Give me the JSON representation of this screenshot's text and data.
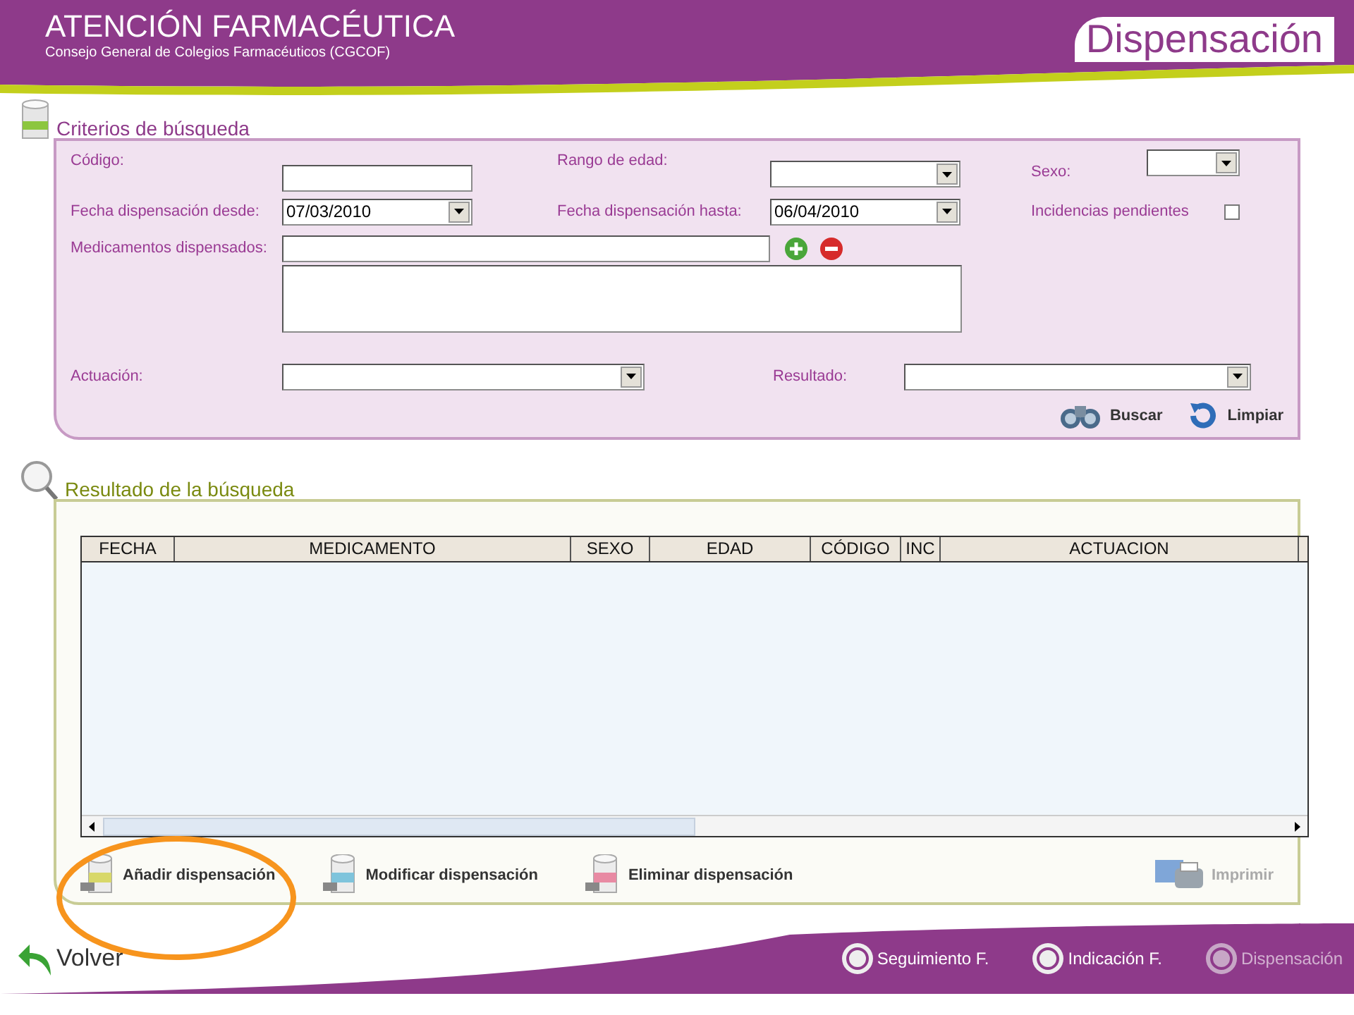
{
  "header": {
    "title": "ATENCIÓN FARMACÉUTICA",
    "subtitle": "Consejo General de Colegios Farmacéuticos (CGCOF)",
    "page_title": "Dispensación"
  },
  "search": {
    "legend": "Criterios de búsqueda",
    "codigo": {
      "label": "Código:"
    },
    "rango_edad": {
      "label": "Rango de edad:"
    },
    "sexo": {
      "label": "Sexo:"
    },
    "fecha_desde": {
      "label": "Fecha dispensación desde:",
      "value": "07/03/2010"
    },
    "fecha_hasta": {
      "label": "Fecha dispensación hasta:",
      "value": "06/04/2010"
    },
    "incidencias": {
      "label": "Incidencias pendientes",
      "checked": false
    },
    "medicamentos": {
      "label": "Medicamentos dispensados:"
    },
    "actuacion": {
      "label": "Actuación:"
    },
    "resultado": {
      "label": "Resultado:"
    },
    "buttons": [
      {
        "label": "Buscar",
        "kind": "search"
      },
      {
        "label": "Limpiar",
        "kind": "clear"
      }
    ]
  },
  "results": {
    "legend": "Resultado de la búsqueda",
    "columns": [
      "FECHA",
      "MEDICAMENTO",
      "SEXO",
      "EDAD",
      "CÓDIGO",
      "INC",
      "ACTUACION"
    ],
    "actions": [
      {
        "label": "Añadir dispensación",
        "kind": "add",
        "disabled": false
      },
      {
        "label": "Modificar dispensación",
        "kind": "edit",
        "disabled": false
      },
      {
        "label": "Eliminar dispensación",
        "kind": "delete",
        "disabled": false
      },
      {
        "label": "Imprimir",
        "kind": "print",
        "disabled": true
      }
    ]
  },
  "footer": {
    "back": "Volver",
    "nav": [
      {
        "label": "Seguimiento F.",
        "selected": false
      },
      {
        "label": "Indicación F.",
        "selected": false
      },
      {
        "label": "Dispensación",
        "selected": true
      }
    ]
  }
}
